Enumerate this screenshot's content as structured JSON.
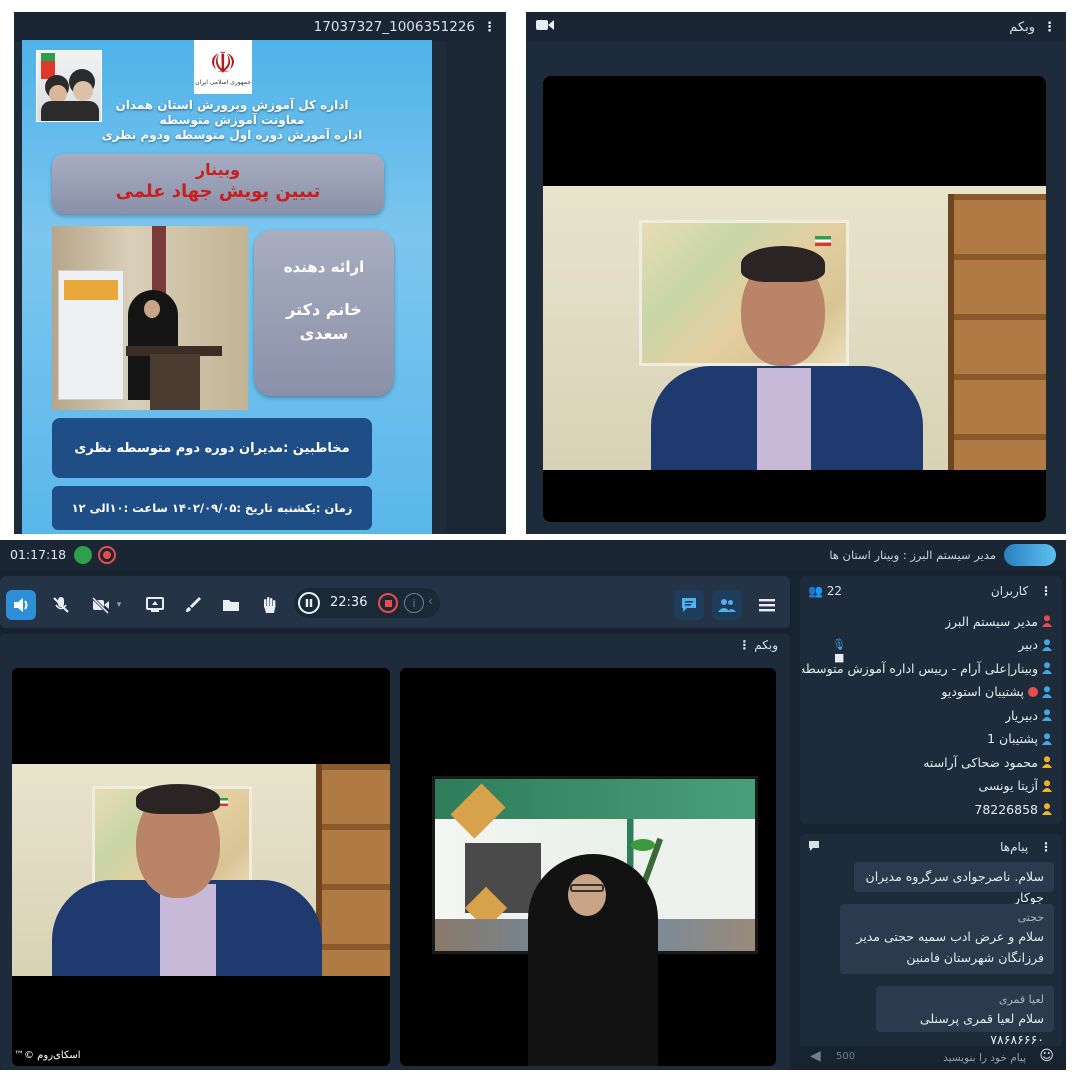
{
  "top_left": {
    "title": "17037327_1006351226",
    "poster": {
      "seal_text": "جمهوری اسلامی ایران",
      "org_line1": "اداره کل آموزش وپرورش استان همدان",
      "org_line2": "معاونت آموزش متوسطه",
      "org_line3": "اداره آموزش دوره اول متوسطه ودوم نظری",
      "webinar_label": "وبینار",
      "webinar_topic": "تبیین پویش جهاد علمی",
      "presenter_label": "ارائه دهنده",
      "presenter_name": "خانم دکتر سعدی",
      "audience": "مخاطبین :مدیران دوره دوم متوسطه نظری",
      "schedule": "زمان :یکشنبه    تاریخ :۱۴۰۲/۰۹/۰۵    ساعت :۱۰الی ۱۲"
    }
  },
  "top_right": {
    "title": "وبکم"
  },
  "bottom": {
    "status": {
      "elapsed": "01:17:18",
      "room_name": "مدیر سیستم البرز : وبینار استان ها"
    },
    "toolbar": {
      "timer": "22:36"
    },
    "webcam_header": "وبکم",
    "watermark": "اسکای‌روم ©™",
    "users": {
      "title": "کاربران",
      "count": "22",
      "items": [
        {
          "name": "مدیر سیستم البرز",
          "color": "#e84d4d"
        },
        {
          "name": "دبیر",
          "color": "#3fa9e6"
        },
        {
          "name": "وبینار|علی آرام - رییس اداره آموزش متوسطه نظری",
          "color": "#3fa9e6"
        },
        {
          "name": "پشتیبان استودیو",
          "color": "#3fa9e6"
        },
        {
          "name": "دبیریار",
          "color": "#3fa9e6"
        },
        {
          "name": "پشتیبان 1",
          "color": "#3fa9e6"
        },
        {
          "name": "محمود ضحاکی آراسته",
          "color": "#f0b429"
        },
        {
          "name": "آزیتا یونسی",
          "color": "#f0b429"
        },
        {
          "name": "78226858",
          "color": "#f0b429"
        }
      ]
    },
    "messages": {
      "title": "پیام‌ها",
      "items": [
        {
          "sender": "",
          "text": "سلام. ناصرجوادی سرگروه مدیران جوکار"
        },
        {
          "sender": "حجتی",
          "text": "سلام و عرض ادب سمیه حجتی مدیر فرزانگان شهرستان فامنین"
        },
        {
          "sender": "لعیا قمری",
          "text": "سلام لعیا قمری پرسنلی ۷۸۶۸۶۶۶۰"
        }
      ],
      "input_placeholder": "پیام خود را بنویسید",
      "char_limit": "500"
    }
  }
}
